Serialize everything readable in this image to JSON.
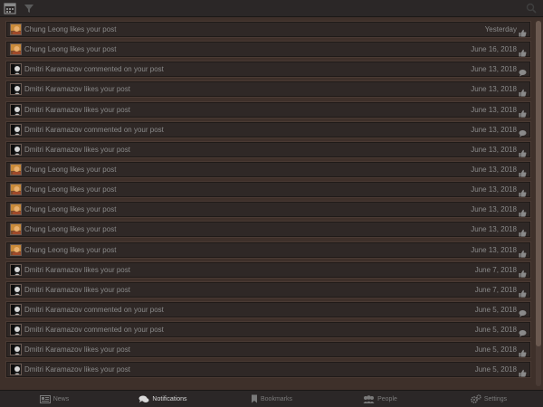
{
  "colors": {
    "background": "#3e302a",
    "row": "#2f2826",
    "text": "#8a8a8a",
    "bar": "#2b2727",
    "active_tab": "#d9d9d9"
  },
  "topbar": {
    "icons": [
      "calendar-icon",
      "filter-icon",
      "search-icon"
    ]
  },
  "notifications": [
    {
      "user": "Chung Leong",
      "action": "likes your post",
      "date": "Yesterday",
      "kind": "like",
      "avatar": "chung"
    },
    {
      "user": "Chung Leong",
      "action": "likes your post",
      "date": "June 16, 2018",
      "kind": "like",
      "avatar": "chung"
    },
    {
      "user": "Dmitri Karamazov",
      "action": "commented on your post",
      "date": "June 13, 2018",
      "kind": "comment",
      "avatar": "dmitri"
    },
    {
      "user": "Dmitri Karamazov",
      "action": "likes your post",
      "date": "June 13, 2018",
      "kind": "like",
      "avatar": "dmitri"
    },
    {
      "user": "Dmitri Karamazov",
      "action": "likes your post",
      "date": "June 13, 2018",
      "kind": "like",
      "avatar": "dmitri"
    },
    {
      "user": "Dmitri Karamazov",
      "action": "commented on your post",
      "date": "June 13, 2018",
      "kind": "comment",
      "avatar": "dmitri"
    },
    {
      "user": "Dmitri Karamazov",
      "action": "likes your post",
      "date": "June 13, 2018",
      "kind": "like",
      "avatar": "dmitri"
    },
    {
      "user": "Chung Leong",
      "action": "likes your post",
      "date": "June 13, 2018",
      "kind": "like",
      "avatar": "chung"
    },
    {
      "user": "Chung Leong",
      "action": "likes your post",
      "date": "June 13, 2018",
      "kind": "like",
      "avatar": "chung"
    },
    {
      "user": "Chung Leong",
      "action": "likes your post",
      "date": "June 13, 2018",
      "kind": "like",
      "avatar": "chung"
    },
    {
      "user": "Chung Leong",
      "action": "likes your post",
      "date": "June 13, 2018",
      "kind": "like",
      "avatar": "chung"
    },
    {
      "user": "Chung Leong",
      "action": "likes your post",
      "date": "June 13, 2018",
      "kind": "like",
      "avatar": "chung"
    },
    {
      "user": "Dmitri Karamazov",
      "action": "likes your post",
      "date": "June 7, 2018",
      "kind": "like",
      "avatar": "dmitri"
    },
    {
      "user": "Dmitri Karamazov",
      "action": "likes your post",
      "date": "June 7, 2018",
      "kind": "like",
      "avatar": "dmitri"
    },
    {
      "user": "Dmitri Karamazov",
      "action": "commented on your post",
      "date": "June 5, 2018",
      "kind": "comment",
      "avatar": "dmitri"
    },
    {
      "user": "Dmitri Karamazov",
      "action": "commented on your post",
      "date": "June 5, 2018",
      "kind": "comment",
      "avatar": "dmitri"
    },
    {
      "user": "Dmitri Karamazov",
      "action": "likes your post",
      "date": "June 5, 2018",
      "kind": "like",
      "avatar": "dmitri"
    },
    {
      "user": "Dmitri Karamazov",
      "action": "likes your post",
      "date": "June 5, 2018",
      "kind": "like",
      "avatar": "dmitri"
    }
  ],
  "tabs": [
    {
      "label": "News",
      "icon": "newspaper-icon",
      "active": false
    },
    {
      "label": "Notifications",
      "icon": "comments-icon",
      "active": true
    },
    {
      "label": "Bookmarks",
      "icon": "bookmark-icon",
      "active": false
    },
    {
      "label": "People",
      "icon": "users-icon",
      "active": false
    },
    {
      "label": "Settings",
      "icon": "gears-icon",
      "active": false
    }
  ]
}
